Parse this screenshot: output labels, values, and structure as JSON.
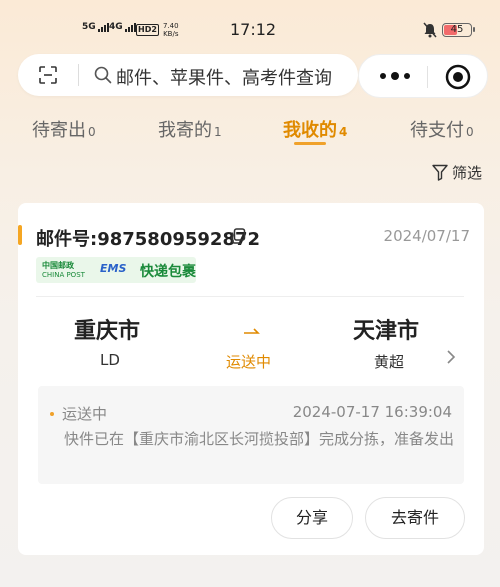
{
  "status_bar": {
    "sim1": "5G",
    "sim2": "4G",
    "hd": "HD2",
    "speed_value": "7.40",
    "speed_unit": "KB/s",
    "time": "17:12",
    "battery": "45"
  },
  "search": {
    "placeholder": "邮件、苹果件、高考件查询"
  },
  "tabs": [
    {
      "label": "待寄出",
      "count": "0"
    },
    {
      "label": "我寄的",
      "count": "1"
    },
    {
      "label": "我收的",
      "count": "4"
    },
    {
      "label": "待支付",
      "count": "0"
    }
  ],
  "active_tab_index": 2,
  "filter": {
    "label": "筛选"
  },
  "shipment": {
    "mail_no": "邮件号:9875809592872",
    "date": "2024/07/17",
    "carrier_logo_cn": "中国邮政",
    "carrier_logo_en": "CHINA POST",
    "carrier_ems": "EMS",
    "carrier_tag": "快递包裹",
    "from_city": "重庆市",
    "from_name": "LD",
    "status": "运送中",
    "to_city": "天津市",
    "to_name": "黄超",
    "latest": {
      "status": "运送中",
      "time": "2024-07-17 16:39:04",
      "description": "快件已在【重庆市渝北区长河揽投部】完成分拣，准备发出"
    },
    "buttons": {
      "share": "分享",
      "send_again": "去寄件"
    }
  },
  "colors": {
    "accent": "#e08a00",
    "tag_green": "#1a8a3a",
    "battery_low": "#f26b6b"
  }
}
